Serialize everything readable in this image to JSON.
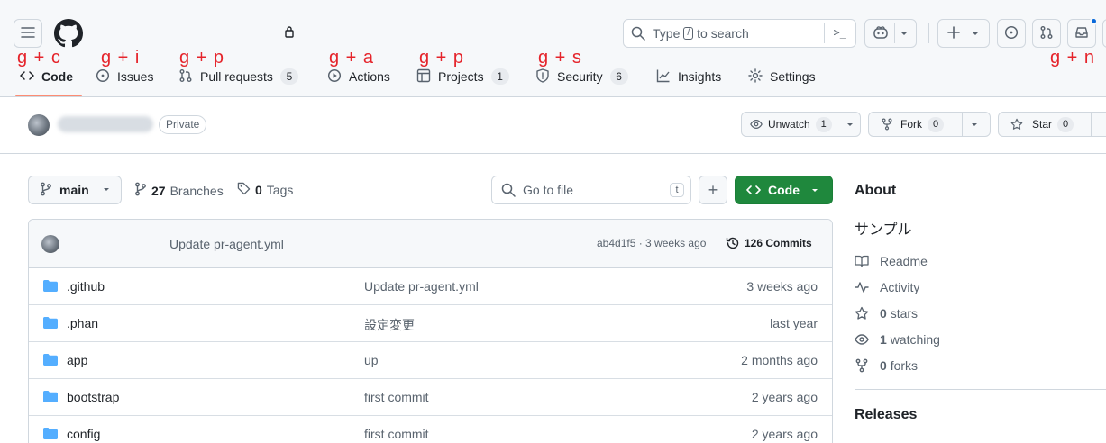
{
  "header": {
    "search_text_before": "Type",
    "search_key": "/",
    "search_text_after": "to search",
    "terminal_symbol": ">_"
  },
  "tabs": [
    {
      "label": "Code",
      "count": ""
    },
    {
      "label": "Issues",
      "count": ""
    },
    {
      "label": "Pull requests",
      "count": "5"
    },
    {
      "label": "Actions",
      "count": ""
    },
    {
      "label": "Projects",
      "count": "1"
    },
    {
      "label": "Security",
      "count": "6"
    },
    {
      "label": "Insights",
      "count": ""
    },
    {
      "label": "Settings",
      "count": ""
    }
  ],
  "shortcuts": {
    "code": "g + c",
    "issues": "g + i",
    "pulls": "g + p",
    "actions": "g + a",
    "projects": "g + p",
    "security": "g + s",
    "notifications": "g + n"
  },
  "repo": {
    "visibility": "Private",
    "unwatch_label": "Unwatch",
    "watch_count": "1",
    "fork_label": "Fork",
    "fork_count": "0",
    "star_label": "Star",
    "star_count": "0"
  },
  "toolbar": {
    "branch": "main",
    "branches_count": "27",
    "branches_label": "Branches",
    "tags_count": "0",
    "tags_label": "Tags",
    "goto_placeholder": "Go to file",
    "goto_key": "t",
    "add_symbol": "+",
    "code_label": "Code"
  },
  "latest_commit": {
    "message": "Update pr-agent.yml",
    "hash_time": "ab4d1f5 · 3 weeks ago",
    "commits": "126 Commits"
  },
  "files": [
    {
      "name": ".github",
      "message": "Update pr-agent.yml",
      "age": "3 weeks ago"
    },
    {
      "name": ".phan",
      "message": "設定変更",
      "age": "last year"
    },
    {
      "name": "app",
      "message": "up",
      "age": "2 months ago"
    },
    {
      "name": "bootstrap",
      "message": "first commit",
      "age": "2 years ago"
    },
    {
      "name": "config",
      "message": "first commit",
      "age": "2 years ago"
    }
  ],
  "about": {
    "title": "About",
    "description": "サンプル",
    "readme": "Readme",
    "activity": "Activity",
    "stars_count": "0",
    "stars_label": "stars",
    "watching_count": "1",
    "watching_label": "watching",
    "forks_count": "0",
    "forks_label": "forks",
    "releases_title": "Releases"
  },
  "colors": {
    "accent_green": "#1f883d",
    "shortcut_red": "#e5242b",
    "tab_underline": "#fd8c73",
    "folder_blue": "#54aeff"
  }
}
